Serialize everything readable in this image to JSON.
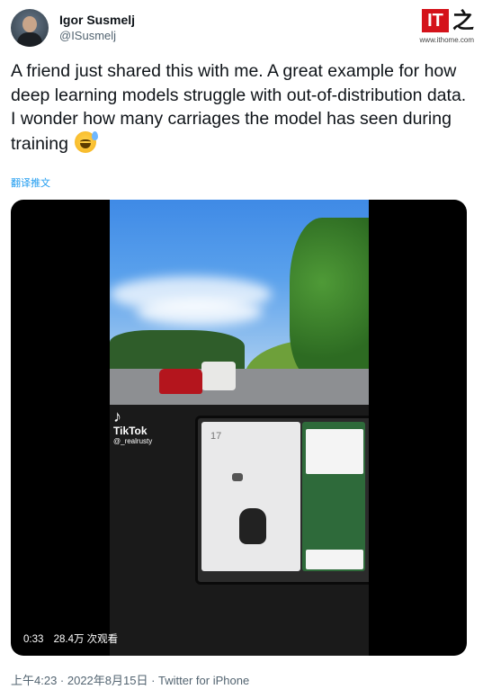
{
  "author": {
    "name": "Igor Susmelj",
    "handle": "@ISusmelj"
  },
  "brand": {
    "logo_text": "IT",
    "logo_char": "之家",
    "url": "www.ithome.com"
  },
  "tweet": {
    "lines": [
      "A friend just shared this with me. A great example for how deep learning models struggle with out-of-distribution data.",
      "I wonder how many carriages the model has seen during training"
    ],
    "emoji": "sweat-smile-emoji",
    "translate_label": "翻译推文"
  },
  "video": {
    "watermark_brand": "TikTok",
    "watermark_user": "@_realrusty",
    "speed_readout": "17",
    "duration": "0:33",
    "views": "28.4万 次观看"
  },
  "meta": {
    "timestamp": "上午4:23 · 2022年8月15日 · Twitter for iPhone"
  }
}
